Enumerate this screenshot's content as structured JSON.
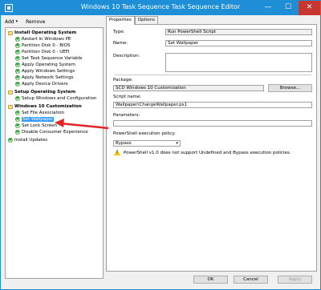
{
  "window": {
    "title": "Windows 10 Task Sequence Task Sequence Editor",
    "controls": {
      "minimize": "—",
      "maximize": "☐",
      "close": "✕"
    }
  },
  "toolbar": {
    "add_label": "Add",
    "remove_label": "Remove"
  },
  "tree": {
    "groups": [
      {
        "label": "Install Operating System",
        "items": [
          "Restart in Windows PE",
          "Partition Disk 0 - BIOS",
          "Partition Disk 0 - UEFI",
          "Set Task Sequence Variable",
          "Apply Operating System",
          "Apply Windows Settings",
          "Apply Network Settings",
          "Apply Device Drivers"
        ]
      },
      {
        "label": "Setup Operating System",
        "items": [
          "Setup Windows and Configuration"
        ]
      },
      {
        "label": "Windows 10 Customization",
        "items": [
          "Set File Association",
          "Set Wallpaper",
          "Set Lock Screen",
          "Disable Consumer Experience"
        ]
      }
    ],
    "trailing_item": "Install Updates",
    "selected_item": "Set Wallpaper"
  },
  "tabs": [
    "Properties",
    "Options"
  ],
  "properties": {
    "type_label": "Type:",
    "type_value": "Run PowerShell Script",
    "name_label": "Name:",
    "name_value": "Set Wallpaper",
    "description_label": "Description:",
    "description_value": "",
    "package_label": "Package:",
    "package_value": "SCD Windows 10 Customization",
    "browse_label": "Browse...",
    "script_name_label": "Script name:",
    "script_name_value": "Wallpaper\\ChangeWallpaper.ps1",
    "parameters_label": "Parameters:",
    "parameters_value": "",
    "policy_label": "PowerShell execution policy:",
    "policy_value": "Bypass",
    "warning_text": "PowerShell v1.0 does not support Undefined and Bypass execution policies."
  },
  "buttons": {
    "ok": "OK",
    "cancel": "Cancel",
    "apply": "Apply"
  },
  "colors": {
    "accent": "#1e8fd6",
    "close": "#c7362f",
    "selection": "#3399ff",
    "arrow": "#e0242a",
    "success": "#3ca53c",
    "warning": "#f2c200"
  }
}
